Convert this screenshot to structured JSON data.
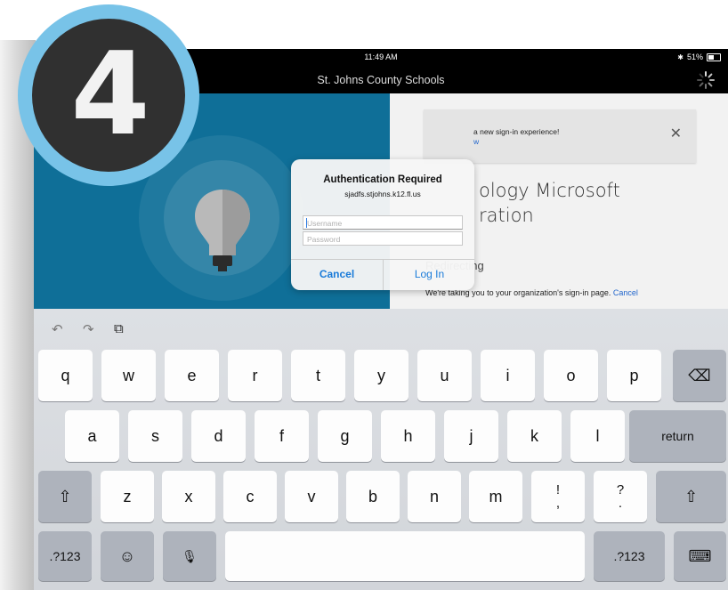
{
  "status_bar": {
    "time": "11:49 AM",
    "battery_text": "51%",
    "battery_level": 0.51
  },
  "nav": {
    "title": "St. Johns County Schools"
  },
  "banner": {
    "text": "a new sign-in experience!",
    "link_text": "w",
    "close_glyph": "✕"
  },
  "org": {
    "line1": "ology Microsoft",
    "line2": "ration"
  },
  "redirect": {
    "heading": "Redirecting",
    "message": "We're taking you to your organization's sign-in page.",
    "cancel_link": "Cancel"
  },
  "dialog": {
    "title": "Authentication Required",
    "subtitle": "sjadfs.stjohns.k12.fl.us",
    "username_placeholder": "Username",
    "password_placeholder": "Password",
    "cancel_label": "Cancel",
    "login_label": "Log In"
  },
  "keyboard": {
    "toolbar": {
      "undo": "↶",
      "redo": "↷",
      "paste": "⧉"
    },
    "row1": [
      "q",
      "w",
      "e",
      "r",
      "t",
      "y",
      "u",
      "i",
      "o",
      "p"
    ],
    "backspace": "⌫",
    "row2": [
      "a",
      "s",
      "d",
      "f",
      "g",
      "h",
      "j",
      "k",
      "l"
    ],
    "return_label": "return",
    "row3": [
      "z",
      "x",
      "c",
      "v",
      "b",
      "n",
      "m"
    ],
    "punct1_top": "!",
    "punct1_bottom": ",",
    "punct2_top": "?",
    "punct2_bottom": ".",
    "shift": "⇧",
    "numbers_label": ".?123",
    "emoji": "☺",
    "mic": "🎙",
    "hide_keyboard": "⌨"
  },
  "badge": {
    "number": "4"
  },
  "colors": {
    "accent": "#1a7bd9",
    "blue_panel": "#0f6f98",
    "badge_ring": "#78c3e8",
    "badge_fill": "#303030"
  }
}
